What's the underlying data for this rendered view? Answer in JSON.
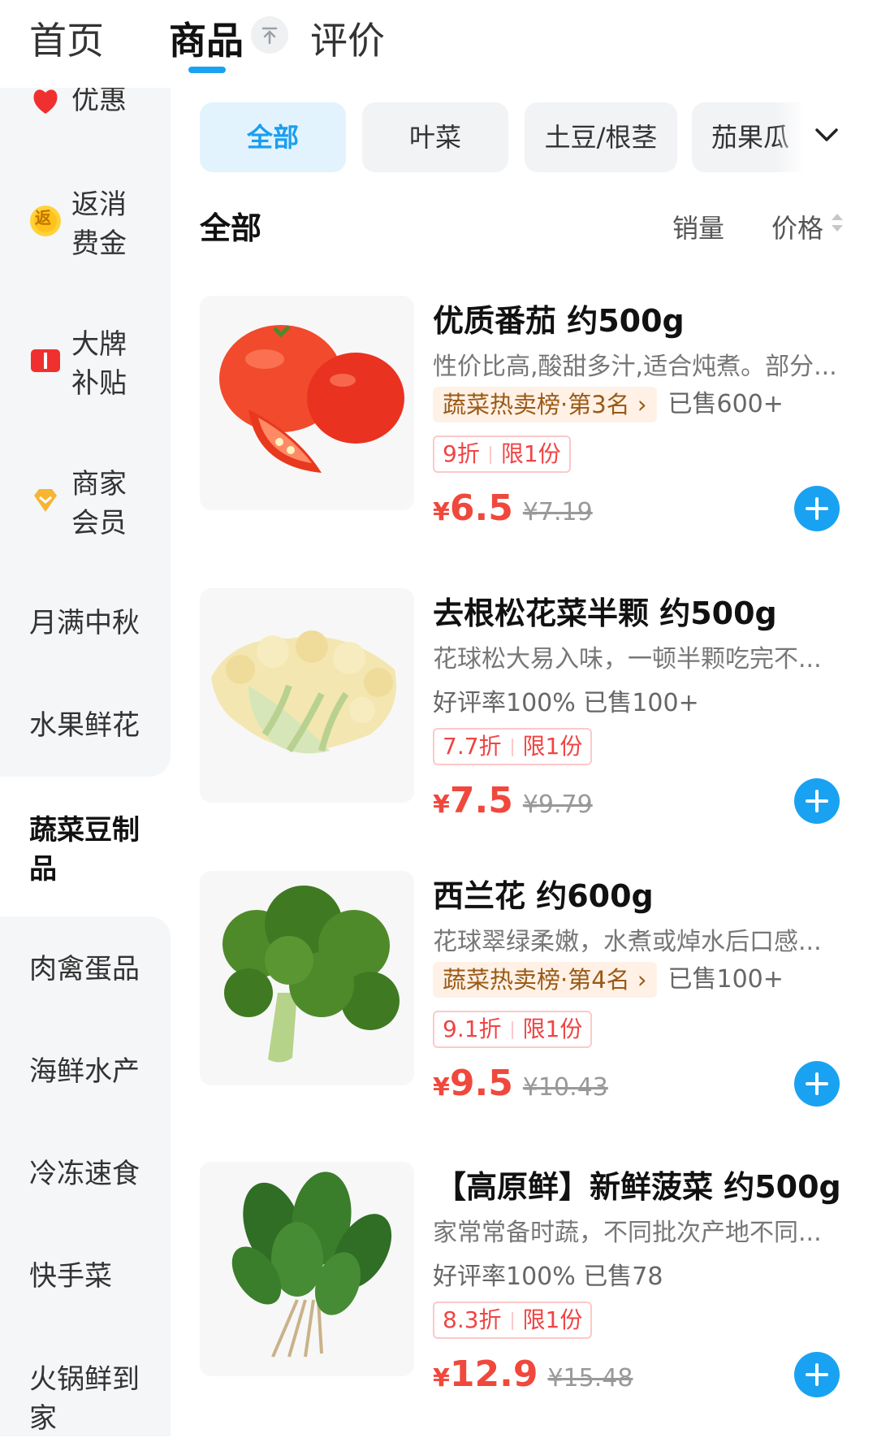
{
  "top_tabs": [
    {
      "label": "首页"
    },
    {
      "label": "商品"
    },
    {
      "label": "评价"
    }
  ],
  "sidebar": {
    "items": [
      {
        "label": "优惠"
      },
      {
        "label": "返消费金"
      },
      {
        "label": "大牌补贴"
      },
      {
        "label": "商家会员"
      },
      {
        "label": "月满中秋"
      },
      {
        "label": "水果鲜花"
      },
      {
        "label": "蔬菜豆制品"
      },
      {
        "label": "肉禽蛋品"
      },
      {
        "label": "海鲜水产"
      },
      {
        "label": "冷冻速食"
      },
      {
        "label": "快手菜"
      },
      {
        "label": "火锅鲜到家"
      }
    ],
    "badge_text": "返"
  },
  "chips": [
    {
      "label": "全部"
    },
    {
      "label": "叶菜"
    },
    {
      "label": "土豆/根茎"
    },
    {
      "label": "茄果瓜"
    }
  ],
  "section": {
    "title": "全部",
    "sort_sales": "销量",
    "sort_price": "价格"
  },
  "products": [
    {
      "name": "优质番茄 约500g",
      "desc": "性价比高,酸甜多汁,适合炖煮。部分...",
      "rank": "蔬菜热卖榜·第3名",
      "sold": "已售600+",
      "discount": "9折",
      "limit": "限1份",
      "yen": "¥",
      "price": "6.5",
      "orig": "¥7.19"
    },
    {
      "name": "去根松花菜半颗 约500g",
      "desc": "花球松大易入味，一顿半颗吃完不...",
      "rating": "好评率100% 已售100+",
      "discount": "7.7折",
      "limit": "限1份",
      "yen": "¥",
      "price": "7.5",
      "orig": "¥9.79"
    },
    {
      "name": "西兰花 约600g",
      "desc": "花球翠绿柔嫩，水煮或焯水后口感...",
      "rank": "蔬菜热卖榜·第4名",
      "sold": "已售100+",
      "discount": "9.1折",
      "limit": "限1份",
      "yen": "¥",
      "price": "9.5",
      "orig": "¥10.43"
    },
    {
      "name": "【高原鲜】新鲜菠菜 约500g",
      "desc": "家常常备时蔬，不同批次产地不同...",
      "rating": "好评率100% 已售78",
      "discount": "8.3折",
      "limit": "限1份",
      "yen": "¥",
      "price": "12.9",
      "orig": "¥15.48"
    }
  ],
  "colors": {
    "accent": "#1aa2f2",
    "price": "#f0483c",
    "rank_text": "#9a5a16"
  },
  "icons": [
    "arrow-up-icon",
    "chevron-down-icon",
    "sort-arrows-icon",
    "plus-icon",
    "red-envelope-icon",
    "coupon-coin-icon",
    "subsidy-icon",
    "vip-diamond-icon"
  ]
}
